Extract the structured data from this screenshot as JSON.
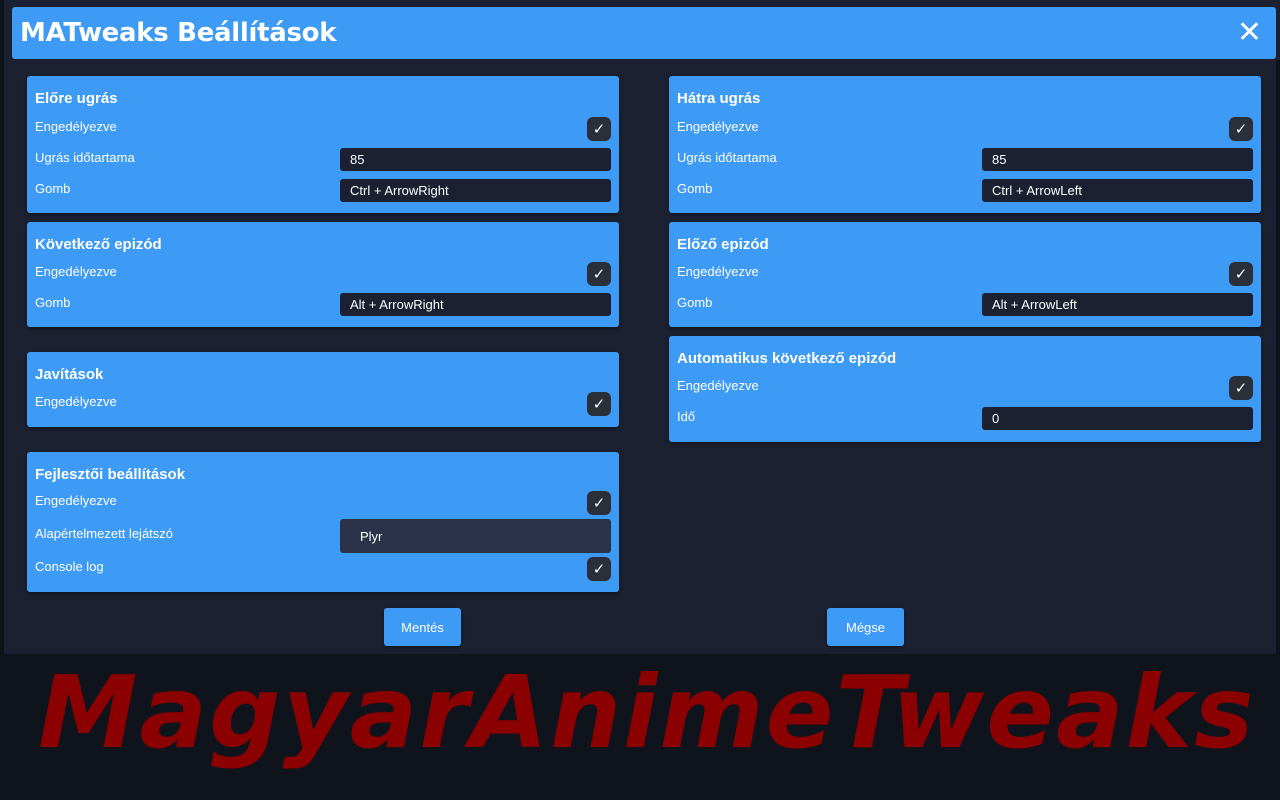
{
  "header": {
    "title": "MATweaks Beállítások",
    "close_glyph": "✕"
  },
  "cards": {
    "forward": {
      "title": "Előre ugrás",
      "enabled_label": "Engedélyezve",
      "duration_label": "Ugrás időtartama",
      "duration_value": "85",
      "key_label": "Gomb",
      "key_value": "Ctrl + ArrowRight",
      "enabled": true
    },
    "backward": {
      "title": "Hátra ugrás",
      "enabled_label": "Engedélyezve",
      "duration_label": "Ugrás időtartama",
      "duration_value": "85",
      "key_label": "Gomb",
      "key_value": "Ctrl + ArrowLeft",
      "enabled": true
    },
    "next": {
      "title": "Következő epizód",
      "enabled_label": "Engedélyezve",
      "key_label": "Gomb",
      "key_value": "Alt + ArrowRight",
      "enabled": true
    },
    "prev": {
      "title": "Előző epizód",
      "enabled_label": "Engedélyezve",
      "key_label": "Gomb",
      "key_value": "Alt + ArrowLeft",
      "enabled": true
    },
    "fixes": {
      "title": "Javítások",
      "enabled_label": "Engedélyezve",
      "enabled": true
    },
    "auto_next": {
      "title": "Automatikus következő epizód",
      "enabled_label": "Engedélyezve",
      "time_label": "Idő",
      "time_value": "0",
      "enabled": true
    },
    "dev": {
      "title": "Fejlesztői beállítások",
      "enabled_label": "Engedélyezve",
      "player_label": "Alapértelmezett lejátszó",
      "player_value": "Plyr",
      "console_label": "Console log",
      "enabled": true,
      "console_enabled": true
    }
  },
  "checkmark": "✓",
  "buttons": {
    "save": "Mentés",
    "cancel": "Mégse"
  },
  "banner": {
    "text": "MagyarAnimeTweaks"
  },
  "colors": {
    "accent": "#3d9af5",
    "background": "#1b2130",
    "banner_text": "#8b0000"
  }
}
